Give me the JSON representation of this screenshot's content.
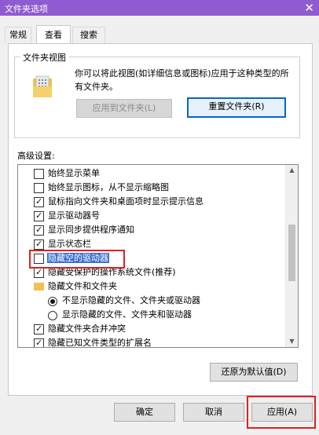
{
  "window": {
    "title": "文件夹选项",
    "close_glyph": "✕"
  },
  "tabs": [
    {
      "label": "常规",
      "active": false
    },
    {
      "label": "查看",
      "active": true
    },
    {
      "label": "搜索",
      "active": false
    }
  ],
  "folder_views": {
    "group_label": "文件夹视图",
    "description": "你可以将此视图(如详细信息或图标)应用于这种类型的所有文件夹。",
    "apply_button": "应用到文件夹(L)",
    "reset_button": "重置文件夹(R)"
  },
  "advanced": {
    "label": "高级设置:",
    "items": [
      {
        "kind": "checkbox",
        "checked": false,
        "label": "始终显示菜单"
      },
      {
        "kind": "checkbox",
        "checked": false,
        "label": "始终显示图标，从不显示缩略图"
      },
      {
        "kind": "checkbox",
        "checked": true,
        "label": "鼠标指向文件夹和桌面项时显示提示信息"
      },
      {
        "kind": "checkbox",
        "checked": true,
        "label": "显示驱动器号"
      },
      {
        "kind": "checkbox",
        "checked": true,
        "label": "显示同步提供程序通知"
      },
      {
        "kind": "checkbox",
        "checked": true,
        "label": "显示状态栏"
      },
      {
        "kind": "checkbox",
        "checked": false,
        "label": "隐藏空的驱动器",
        "selected": true
      },
      {
        "kind": "checkbox",
        "checked": true,
        "label": "隐藏受保护的操作系统文件(推荐)"
      },
      {
        "kind": "folder",
        "label": "隐藏文件和文件夹"
      },
      {
        "kind": "radio",
        "checked": true,
        "label": "不显示隐藏的文件、文件夹或驱动器"
      },
      {
        "kind": "radio",
        "checked": false,
        "label": "显示隐藏的文件、文件夹和驱动器"
      },
      {
        "kind": "checkbox",
        "checked": true,
        "label": "隐藏文件夹合并冲突"
      },
      {
        "kind": "checkbox",
        "checked": true,
        "label": "隐藏已知文件类型的扩展名"
      }
    ],
    "restore_button": "还原为默认值(D)"
  },
  "footer": {
    "ok": "确定",
    "cancel": "取消",
    "apply": "应用(A)"
  },
  "colors": {
    "titlebar": "#8f5bd1",
    "highlight": "#e02020",
    "selection": "#3a6fd0"
  }
}
